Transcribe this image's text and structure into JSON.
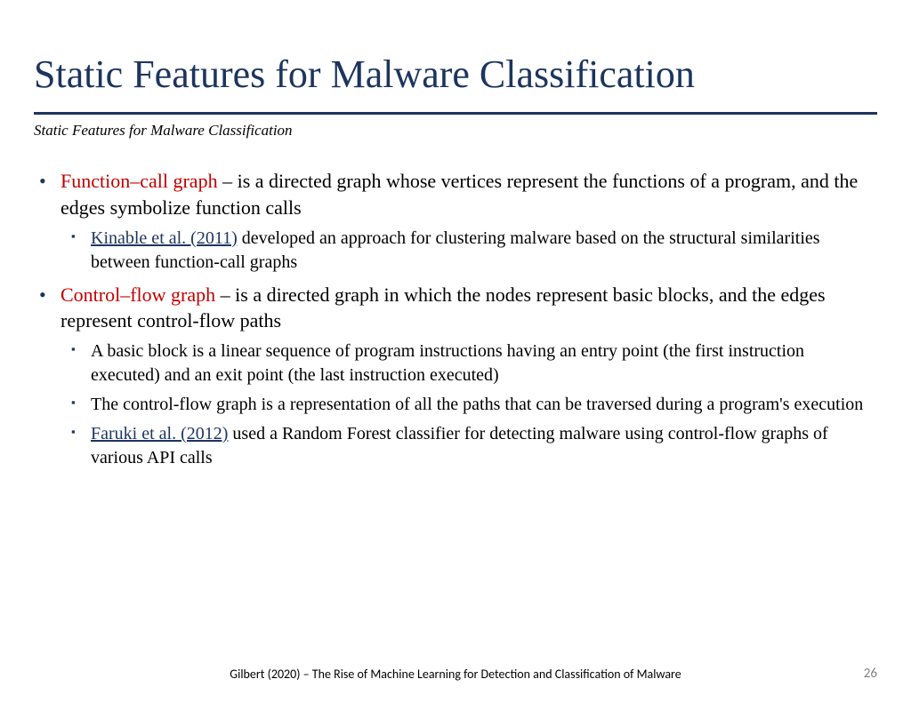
{
  "title": "Static Features for Malware Classification",
  "subtitle": "Static Features for Malware Classification",
  "items": [
    {
      "term": "Function–call graph",
      "desc": " – is a directed graph whose vertices represent the functions of a program, and the edges symbolize function calls",
      "subs": [
        {
          "link": "Kinable et al. (2011)",
          "text": " developed an approach for clustering malware based on the structural similarities between function-call graphs"
        }
      ]
    },
    {
      "term": "Control–flow graph",
      "desc": " – is a directed graph in which the nodes represent basic blocks, and the edges represent control-flow paths",
      "subs": [
        {
          "text": "A basic block is a linear sequence of program instructions having an entry point (the first instruction executed) and an exit point (the last instruction executed)"
        },
        {
          "text": "The control-flow graph is a representation of all the paths that can be traversed during a program's execution"
        },
        {
          "link": "Faruki et al. (2012)",
          "text": " used a Random Forest classifier for detecting malware using control-flow graphs of various API calls"
        }
      ]
    }
  ],
  "footer": "Gilbert (2020) – The Rise of Machine Learning for Detection and Classification of Malware",
  "pageNumber": "26"
}
